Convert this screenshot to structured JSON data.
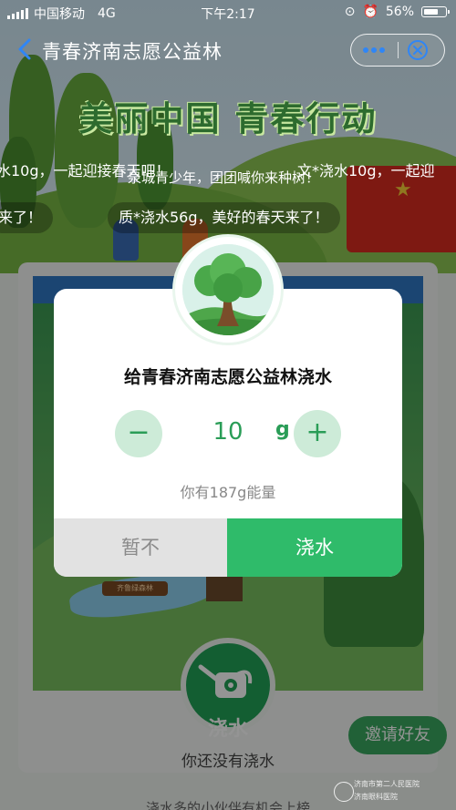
{
  "status_bar": {
    "carrier": "中国移动",
    "network": "4G",
    "time": "下午2:17",
    "battery": "56%",
    "battery_level": 0.56
  },
  "nav": {
    "title": "青春济南志愿公益林"
  },
  "banner": {
    "title": "美丽中国  青春行动"
  },
  "bullets": [
    "水10g，一起迎接春天吧！",
    "文*浇水10g，一起迎",
    "泉城青少年，团团喊你来种树！",
    "来了！",
    "质*浇水56g，美好的春天来了！"
  ],
  "scene": {
    "sign_text": "齐鲁绿森林"
  },
  "modal": {
    "title": "给青春济南志愿公益林浇水",
    "minus": "−",
    "plus": "+",
    "amount": "10",
    "unit": "g",
    "energy_text": "你有187g能量",
    "cancel_label": "暂不",
    "confirm_label": "浇水"
  },
  "bottom": {
    "water_label": "浇水",
    "status_text": "你还没有浇水",
    "invite_label": "邀请好友",
    "hint_text": "浇水多的小伙伴有机会上榜"
  },
  "watermark": {
    "line1": "济南市第二人民医院",
    "line2": "济南眼科医院"
  },
  "colors": {
    "primary_green": "#2fbb6a",
    "stepper_bg": "#cdebd8",
    "cancel_bg": "#e2e2e2"
  }
}
